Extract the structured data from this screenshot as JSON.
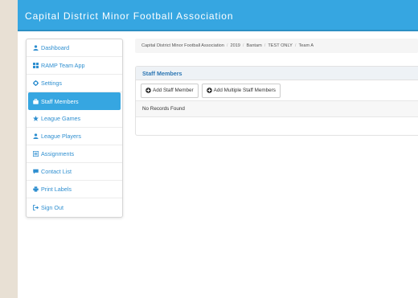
{
  "header": {
    "title": "Capital District Minor Football Association"
  },
  "sidebar": {
    "items": [
      {
        "label": "Dashboard",
        "icon": "user-icon"
      },
      {
        "label": "RAMP Team App",
        "icon": "grid-icon"
      },
      {
        "label": "Settings",
        "icon": "gear-icon"
      },
      {
        "label": "Staff Members",
        "icon": "briefcase-icon"
      },
      {
        "label": "League Games",
        "icon": "star-icon"
      },
      {
        "label": "League Players",
        "icon": "user-icon"
      },
      {
        "label": "Assignments",
        "icon": "list-icon"
      },
      {
        "label": "Contact List",
        "icon": "comment-icon"
      },
      {
        "label": "Print Labels",
        "icon": "print-icon"
      },
      {
        "label": "Sign Out",
        "icon": "sign-out-icon"
      }
    ],
    "active_index": 3
  },
  "breadcrumb": {
    "items": [
      "Capital District Minor Football Association",
      "2019",
      "Bantam",
      "TEST ONLY",
      "Team A"
    ],
    "separator": "/"
  },
  "panel": {
    "title": "Staff Members",
    "buttons": {
      "add_staff": "Add Staff Member",
      "add_multiple": "Add Multiple Staff Members"
    },
    "empty_text": "No Records Found"
  },
  "colors": {
    "accent": "#36a6e1",
    "link": "#2f8fd0",
    "page_bg": "#e8e0d4"
  }
}
